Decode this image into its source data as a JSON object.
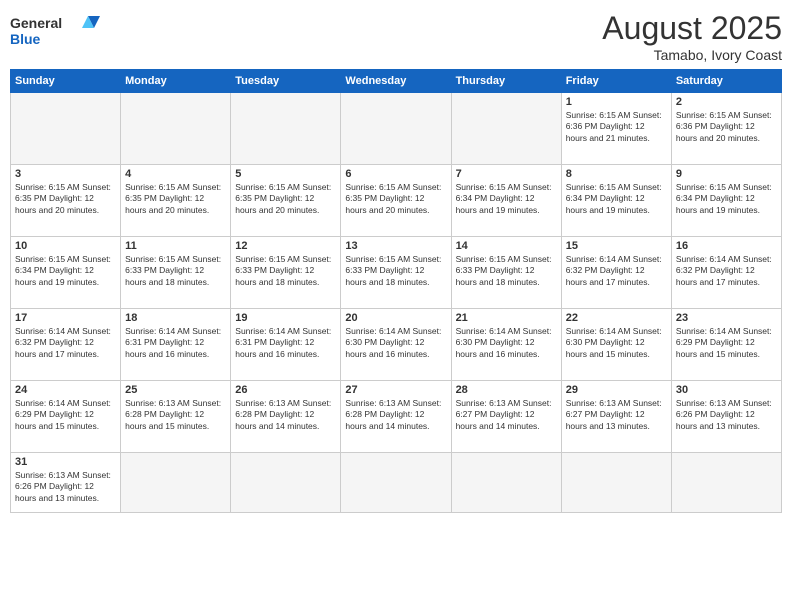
{
  "header": {
    "logo_general": "General",
    "logo_blue": "Blue",
    "month_year": "August 2025",
    "location": "Tamabo, Ivory Coast"
  },
  "days_of_week": [
    "Sunday",
    "Monday",
    "Tuesday",
    "Wednesday",
    "Thursday",
    "Friday",
    "Saturday"
  ],
  "weeks": [
    [
      {
        "day": "",
        "info": ""
      },
      {
        "day": "",
        "info": ""
      },
      {
        "day": "",
        "info": ""
      },
      {
        "day": "",
        "info": ""
      },
      {
        "day": "",
        "info": ""
      },
      {
        "day": "1",
        "info": "Sunrise: 6:15 AM\nSunset: 6:36 PM\nDaylight: 12 hours\nand 21 minutes."
      },
      {
        "day": "2",
        "info": "Sunrise: 6:15 AM\nSunset: 6:36 PM\nDaylight: 12 hours\nand 20 minutes."
      }
    ],
    [
      {
        "day": "3",
        "info": "Sunrise: 6:15 AM\nSunset: 6:35 PM\nDaylight: 12 hours\nand 20 minutes."
      },
      {
        "day": "4",
        "info": "Sunrise: 6:15 AM\nSunset: 6:35 PM\nDaylight: 12 hours\nand 20 minutes."
      },
      {
        "day": "5",
        "info": "Sunrise: 6:15 AM\nSunset: 6:35 PM\nDaylight: 12 hours\nand 20 minutes."
      },
      {
        "day": "6",
        "info": "Sunrise: 6:15 AM\nSunset: 6:35 PM\nDaylight: 12 hours\nand 20 minutes."
      },
      {
        "day": "7",
        "info": "Sunrise: 6:15 AM\nSunset: 6:34 PM\nDaylight: 12 hours\nand 19 minutes."
      },
      {
        "day": "8",
        "info": "Sunrise: 6:15 AM\nSunset: 6:34 PM\nDaylight: 12 hours\nand 19 minutes."
      },
      {
        "day": "9",
        "info": "Sunrise: 6:15 AM\nSunset: 6:34 PM\nDaylight: 12 hours\nand 19 minutes."
      }
    ],
    [
      {
        "day": "10",
        "info": "Sunrise: 6:15 AM\nSunset: 6:34 PM\nDaylight: 12 hours\nand 19 minutes."
      },
      {
        "day": "11",
        "info": "Sunrise: 6:15 AM\nSunset: 6:33 PM\nDaylight: 12 hours\nand 18 minutes."
      },
      {
        "day": "12",
        "info": "Sunrise: 6:15 AM\nSunset: 6:33 PM\nDaylight: 12 hours\nand 18 minutes."
      },
      {
        "day": "13",
        "info": "Sunrise: 6:15 AM\nSunset: 6:33 PM\nDaylight: 12 hours\nand 18 minutes."
      },
      {
        "day": "14",
        "info": "Sunrise: 6:15 AM\nSunset: 6:33 PM\nDaylight: 12 hours\nand 18 minutes."
      },
      {
        "day": "15",
        "info": "Sunrise: 6:14 AM\nSunset: 6:32 PM\nDaylight: 12 hours\nand 17 minutes."
      },
      {
        "day": "16",
        "info": "Sunrise: 6:14 AM\nSunset: 6:32 PM\nDaylight: 12 hours\nand 17 minutes."
      }
    ],
    [
      {
        "day": "17",
        "info": "Sunrise: 6:14 AM\nSunset: 6:32 PM\nDaylight: 12 hours\nand 17 minutes."
      },
      {
        "day": "18",
        "info": "Sunrise: 6:14 AM\nSunset: 6:31 PM\nDaylight: 12 hours\nand 16 minutes."
      },
      {
        "day": "19",
        "info": "Sunrise: 6:14 AM\nSunset: 6:31 PM\nDaylight: 12 hours\nand 16 minutes."
      },
      {
        "day": "20",
        "info": "Sunrise: 6:14 AM\nSunset: 6:30 PM\nDaylight: 12 hours\nand 16 minutes."
      },
      {
        "day": "21",
        "info": "Sunrise: 6:14 AM\nSunset: 6:30 PM\nDaylight: 12 hours\nand 16 minutes."
      },
      {
        "day": "22",
        "info": "Sunrise: 6:14 AM\nSunset: 6:30 PM\nDaylight: 12 hours\nand 15 minutes."
      },
      {
        "day": "23",
        "info": "Sunrise: 6:14 AM\nSunset: 6:29 PM\nDaylight: 12 hours\nand 15 minutes."
      }
    ],
    [
      {
        "day": "24",
        "info": "Sunrise: 6:14 AM\nSunset: 6:29 PM\nDaylight: 12 hours\nand 15 minutes."
      },
      {
        "day": "25",
        "info": "Sunrise: 6:13 AM\nSunset: 6:28 PM\nDaylight: 12 hours\nand 15 minutes."
      },
      {
        "day": "26",
        "info": "Sunrise: 6:13 AM\nSunset: 6:28 PM\nDaylight: 12 hours\nand 14 minutes."
      },
      {
        "day": "27",
        "info": "Sunrise: 6:13 AM\nSunset: 6:28 PM\nDaylight: 12 hours\nand 14 minutes."
      },
      {
        "day": "28",
        "info": "Sunrise: 6:13 AM\nSunset: 6:27 PM\nDaylight: 12 hours\nand 14 minutes."
      },
      {
        "day": "29",
        "info": "Sunrise: 6:13 AM\nSunset: 6:27 PM\nDaylight: 12 hours\nand 13 minutes."
      },
      {
        "day": "30",
        "info": "Sunrise: 6:13 AM\nSunset: 6:26 PM\nDaylight: 12 hours\nand 13 minutes."
      }
    ],
    [
      {
        "day": "31",
        "info": "Sunrise: 6:13 AM\nSunset: 6:26 PM\nDaylight: 12 hours\nand 13 minutes."
      },
      {
        "day": "",
        "info": ""
      },
      {
        "day": "",
        "info": ""
      },
      {
        "day": "",
        "info": ""
      },
      {
        "day": "",
        "info": ""
      },
      {
        "day": "",
        "info": ""
      },
      {
        "day": "",
        "info": ""
      }
    ]
  ]
}
